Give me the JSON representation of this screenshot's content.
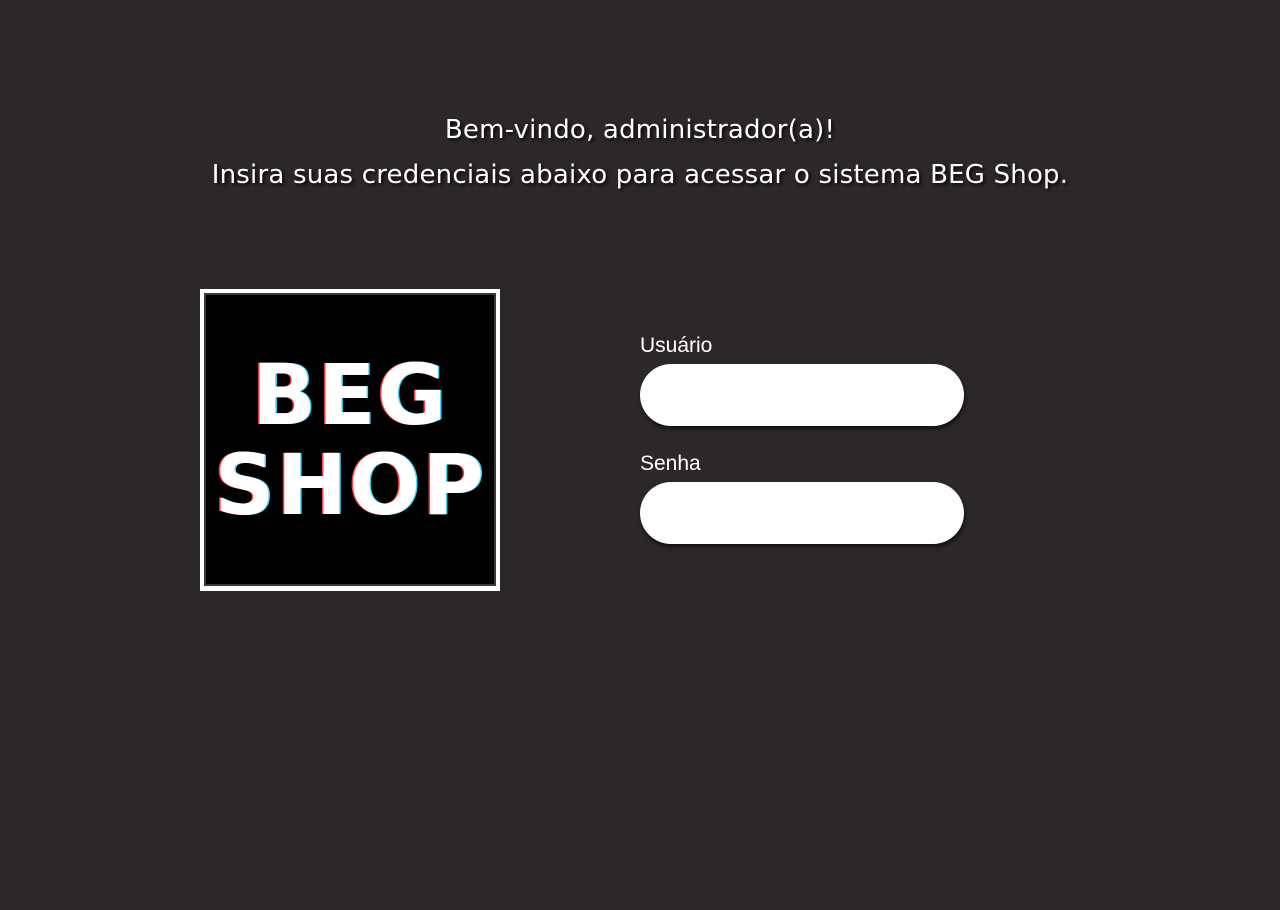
{
  "header": {
    "welcome": "Bem-vindo, administrador(a)!",
    "instructions": "Insira suas credenciais abaixo para acessar o sistema BEG Shop."
  },
  "logo": {
    "line1": "BEG",
    "line2": "SHOP"
  },
  "login_form": {
    "username": {
      "label": "Usuário",
      "value": ""
    },
    "password": {
      "label": "Senha",
      "value": ""
    }
  },
  "colors": {
    "background": "#2d2828",
    "text": "#ffffff",
    "input_background": "#ffffff",
    "logo_background": "#000000"
  }
}
